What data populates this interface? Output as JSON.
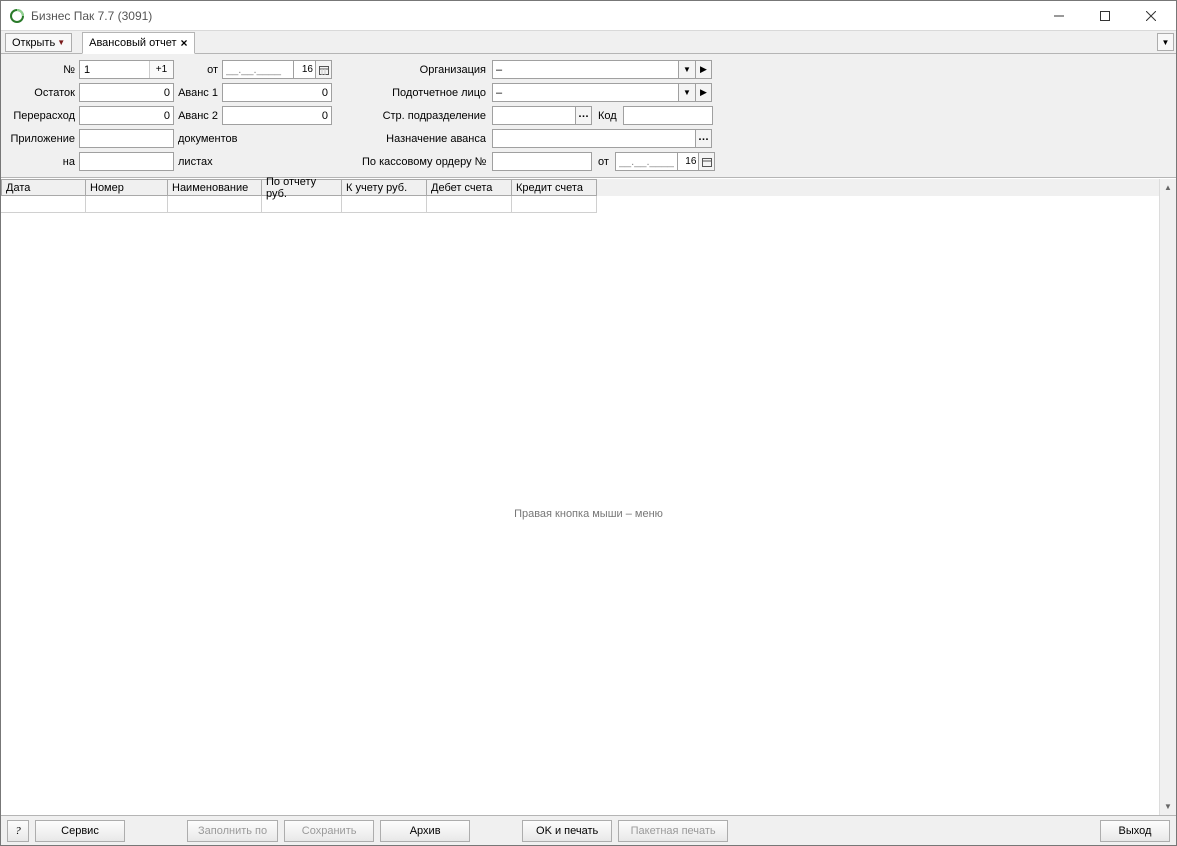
{
  "window": {
    "title": "Бизнес Пак 7.7 (3091)"
  },
  "tabstrip": {
    "open_label": "Открыть",
    "tab_label": "Авансовый отчет"
  },
  "form": {
    "labels": {
      "number": "№",
      "ot": "от",
      "ostatok": "Остаток",
      "avans1": "Аванс 1",
      "pererashod": "Перерасход",
      "avans2": "Аванс 2",
      "prilozhenie": "Приложение",
      "dokumentov": "документов",
      "na": "на",
      "listah": "листах",
      "organizaciya": "Организация",
      "podotchetnoe_lico": "Подотчетное лицо",
      "str_podrazdelenie": "Стр. подразделение",
      "kod": "Код",
      "naznachenie_avansa": "Назначение аванса",
      "po_kassovomu_orderu": "По кассовому ордеру №",
      "ot2": "от"
    },
    "values": {
      "number": "1",
      "number_spin": "+1",
      "date1_mask": "__.__.____",
      "date1_num": "16",
      "ostatok": "0",
      "avans1": "0",
      "pererashod": "0",
      "avans2": "0",
      "prilozhenie": "",
      "na": "",
      "organizaciya": "–",
      "podotchetnoe_lico": "–",
      "str_podrazdelenie": "",
      "kod": "",
      "naznachenie_avansa": "",
      "kassovy_order_no": "",
      "date2_mask": "__.__.____",
      "date2_num": "16"
    }
  },
  "table": {
    "headers": [
      "Дата",
      "Номер",
      "Наименование",
      "По отчету руб.",
      "К учету руб.",
      "Дебет счета",
      "Кредит счета"
    ],
    "hint": "Правая кнопка мыши – меню"
  },
  "bottombar": {
    "help": "?",
    "service": "Сервис",
    "fill_by": "Заполнить по",
    "save": "Сохранить",
    "archive": "Архив",
    "ok_print": "OK и печать",
    "batch_print": "Пакетная печать",
    "exit": "Выход"
  }
}
